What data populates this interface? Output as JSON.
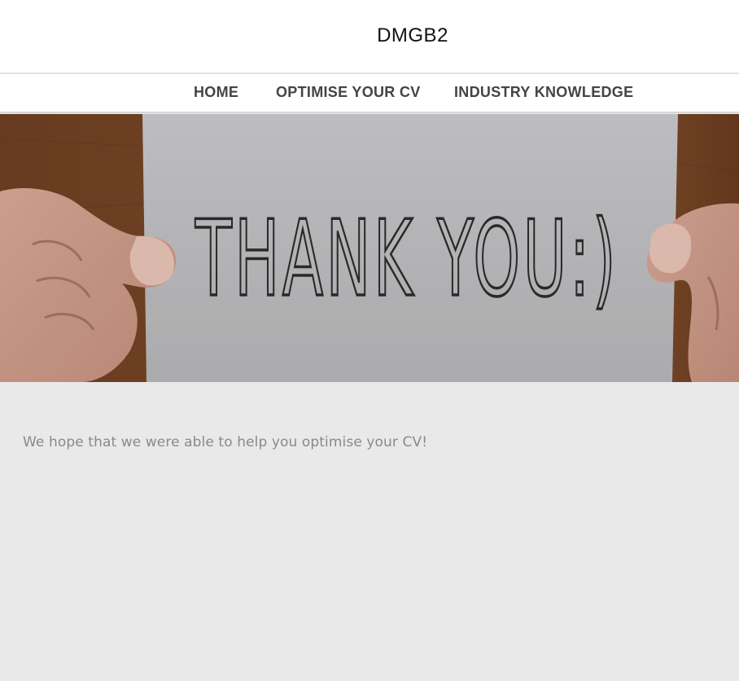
{
  "site": {
    "title": "DMGB2"
  },
  "nav": {
    "items": [
      {
        "label": "HOME"
      },
      {
        "label": "OPTIMISE YOUR CV"
      },
      {
        "label": "INDUSTRY KNOWLEDGE"
      }
    ]
  },
  "hero": {
    "card_text": "THANK YOU:)"
  },
  "content": {
    "message": "We hope that we were able to help you optimise your CV!"
  },
  "colors": {
    "header_bg": "#ffffff",
    "nav_text": "#444444",
    "page_bg": "#e9e9e9",
    "body_text": "#8a8a8a",
    "wood": "#7a4a2a",
    "card": "#bdbdbf"
  }
}
